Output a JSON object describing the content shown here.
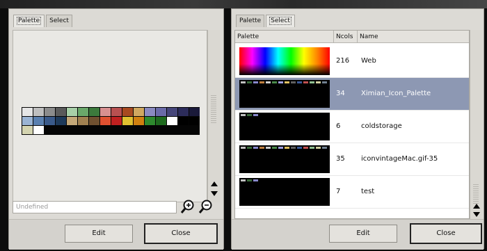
{
  "left": {
    "tabs": [
      "Palette",
      "Select"
    ],
    "name_placeholder": "Undefined",
    "buttons": {
      "edit": "Edit",
      "close": "Close"
    },
    "swatches": [
      "#e6e6e6",
      "#bfbfbf",
      "#8c8c8c",
      "#5a5a5a",
      "#a8d0a8",
      "#6aa86a",
      "#3c7a3c",
      "#d89090",
      "#b85050",
      "#a84a20",
      "#d0a860",
      "#8a8ac0",
      "#6a6aa8",
      "#46467a",
      "#2c2c5a",
      "#1a1a3a",
      "#9ab4d4",
      "#5a80b0",
      "#3a5a8a",
      "#1e3a5a",
      "#c4a878",
      "#a08050",
      "#705030",
      "#e05030",
      "#c02020",
      "#e0c030",
      "#d08010",
      "#2e8a2e",
      "#1e6a1e",
      "#ffffff",
      "#000000",
      "#000000",
      "#d4d4b0",
      "#ffffff"
    ]
  },
  "right": {
    "tabs": [
      "Palette",
      "Select"
    ],
    "headers": {
      "palette": "Palette",
      "ncols": "Ncols",
      "name": "Name"
    },
    "rows": [
      {
        "ncols": "216",
        "name": "Web",
        "selected": false,
        "kind": "web"
      },
      {
        "ncols": "34",
        "name": "Ximian_Icon_Palette",
        "selected": true,
        "kind": "strip"
      },
      {
        "ncols": "6",
        "name": "coldstorage",
        "selected": false,
        "kind": "short"
      },
      {
        "ncols": "35",
        "name": "iconvintageMac.gif-35",
        "selected": false,
        "kind": "strip"
      },
      {
        "ncols": "7",
        "name": "test",
        "selected": false,
        "kind": "short"
      }
    ],
    "buttons": {
      "edit": "Edit",
      "close": "Close"
    }
  },
  "colors": {
    "selection": "#8d98b3",
    "dialog_bg": "#dcdad5",
    "screen_bg": "#0c0c0c"
  }
}
